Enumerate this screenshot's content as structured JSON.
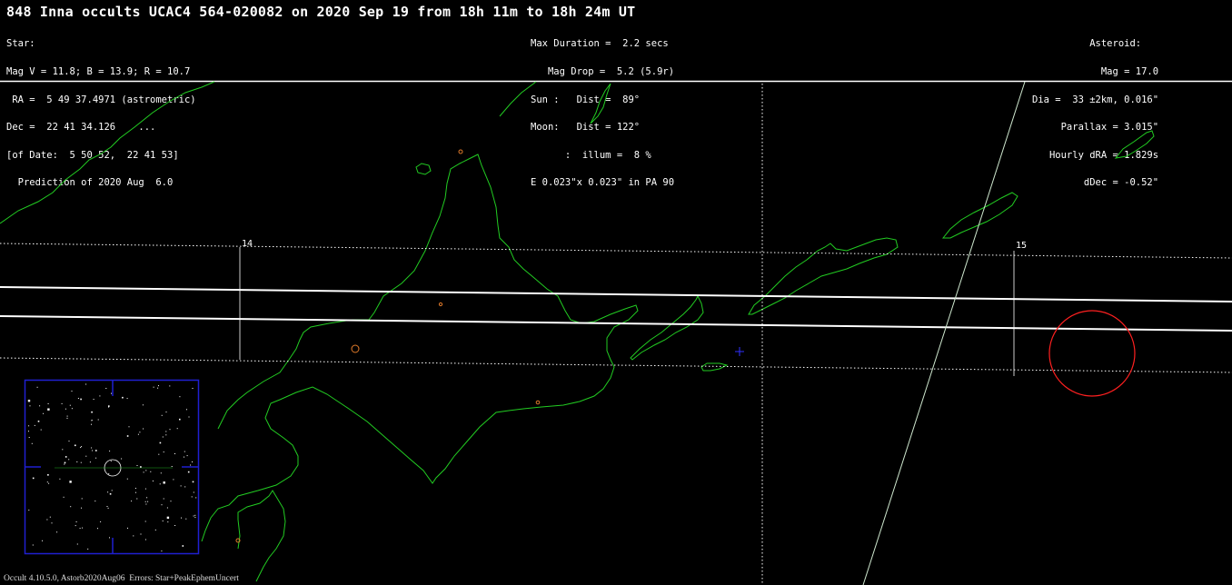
{
  "title": "848 Inna occults UCAC4 564-020082 on 2020 Sep 19 from 18h 11m to 18h 24m UT",
  "star": {
    "lines": [
      "Star:",
      "Mag V = 11.8; B = 13.9; R = 10.7",
      " RA =  5 49 37.4971 (astrometric)",
      "Dec =  22 41 34.126    ...",
      "[of Date:  5 50 52,  22 41 53]",
      "  Prediction of 2020 Aug  6.0"
    ]
  },
  "event": {
    "lines": [
      "Max Duration =  2.2 secs",
      "   Mag Drop =  5.2 (5.9r)",
      "Sun :   Dist =  89°",
      "Moon:   Dist = 122°",
      "      :  illum =  8 %",
      "E 0.023\"x 0.023\" in PA 90"
    ]
  },
  "asteroid": {
    "lines": [
      "Asteroid:   ",
      "Mag = 17.0",
      "Dia =  33 ±2km, 0.016\"",
      "Parallax = 3.015\"",
      "Hourly dRA = 1.829s",
      "dDec = -0.52\""
    ]
  },
  "map": {
    "time_marks": [
      "14",
      "15"
    ],
    "colors": {
      "background": "#000000",
      "coastline": "#22cc22",
      "path": "#ffffff",
      "sites": "#e07a2a",
      "target": "#ff2020",
      "center_cross": "#3030ff",
      "inset_border": "#1f1fd0"
    },
    "icons": [
      "shadow-path",
      "uncertainty-limits",
      "coastline",
      "observer-sites",
      "star-field-inset",
      "target-circle"
    ]
  },
  "footer": "Occult 4.10.5.0, Astorb2020Aug06  Errors: Star+PeakEphemUncert"
}
